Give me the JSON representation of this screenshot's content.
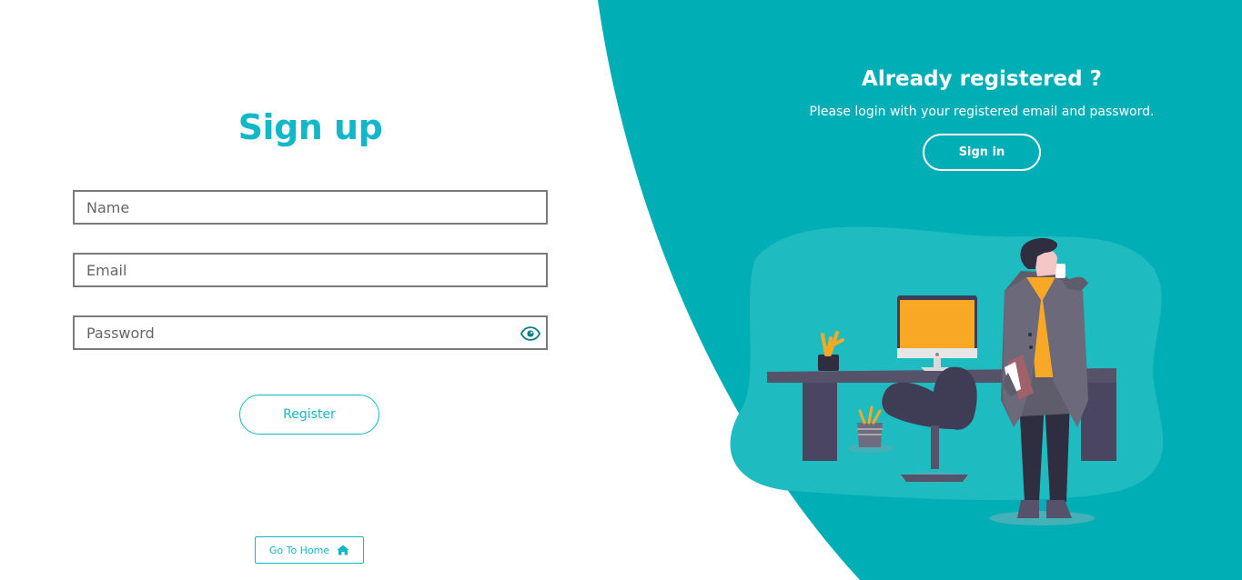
{
  "colors": {
    "accent": "#13b8c8",
    "panel": "#00aeb5",
    "blob": "#1ebbc1",
    "monitor_screen": "#f9a826",
    "desk": "#56526a",
    "coat": "#5f5d6b"
  },
  "signup": {
    "title": "Sign up",
    "name_placeholder": "Name",
    "email_placeholder": "Email",
    "password_placeholder": "Password",
    "show_password_icon": "eye-icon",
    "register_label": "Register",
    "home_label": "Go To Home",
    "home_icon": "home-icon"
  },
  "login_panel": {
    "title": "Already registered ?",
    "subtitle": "Please login with your registered email and password.",
    "signin_label": "Sign in",
    "illustration": "office-person-illustration"
  }
}
